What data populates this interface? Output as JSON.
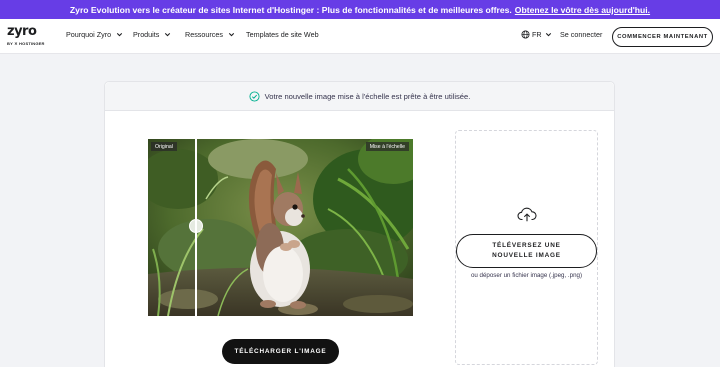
{
  "banner": {
    "text": "Zyro Evolution vers le créateur de sites Internet d'Hostinger : Plus de fonctionnalités et de meilleures offres.",
    "link": "Obtenez le vôtre dès aujourd'hui."
  },
  "header": {
    "logo_text": "zyro",
    "logo_sub": "BY ✕ HOSTINGER",
    "nav": {
      "pourquoi": "Pourquoi Zyro",
      "produits": "Produits",
      "ressources": "Ressources",
      "templates": "Templates de site Web"
    },
    "language": "FR",
    "login": "Se connecter",
    "cta": "COMMENCER MAINTENANT"
  },
  "status": {
    "message": "Votre nouvelle image mise à l'échelle est prête à être utilisée."
  },
  "comparison": {
    "original_label": "Original",
    "upscaled_label": "Mise à l'échelle"
  },
  "actions": {
    "download": "TÉLÉCHARGER L'IMAGE"
  },
  "upload": {
    "button": "TÉLÉVERSEZ UNE NOUVELLE IMAGE",
    "hint": "ou déposer un fichier image (.jpeg, .png)"
  },
  "colors": {
    "brand": "#673de6",
    "success": "#00b090",
    "dark_button": "#121212"
  },
  "icons": [
    "check-circle-icon",
    "globe-icon",
    "chevron-down-icon",
    "cloud-upload-icon"
  ]
}
